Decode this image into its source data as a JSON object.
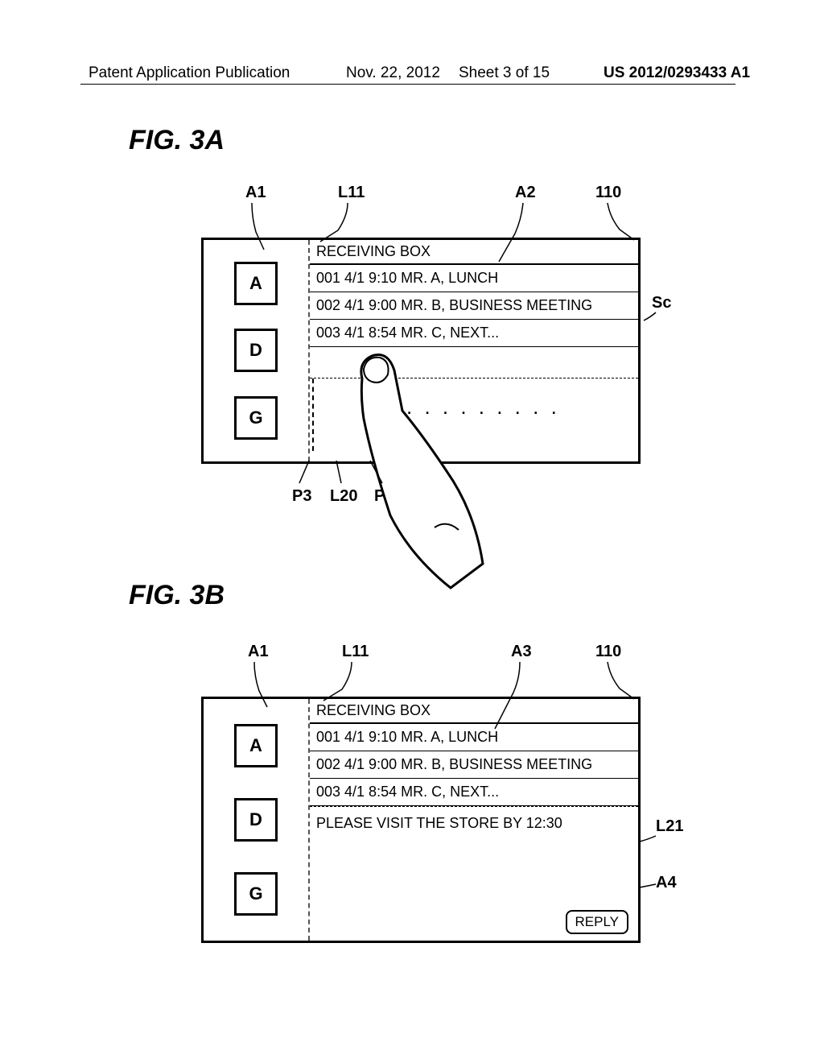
{
  "header": {
    "publication": "Patent Application Publication",
    "date": "Nov. 22, 2012",
    "sheet": "Sheet 3 of 15",
    "number": "US 2012/0293433 A1"
  },
  "figA": {
    "title": "FIG. 3A",
    "callouts": {
      "a1": "A1",
      "l11": "L11",
      "a2": "A2",
      "n110": "110",
      "sc": "Sc",
      "p3": "P3",
      "l20": "L20",
      "p4": "P4"
    },
    "sidebar": [
      "A",
      "D",
      "G"
    ],
    "screen_title": "RECEIVING BOX",
    "rows": [
      "001 4/1 9:10 MR. A, LUNCH",
      "002 4/1 9:00 MR. B, BUSINESS MEETING",
      "003 4/1 8:54 MR. C, NEXT..."
    ],
    "dots": ". . . . . . . . ."
  },
  "figB": {
    "title": "FIG. 3B",
    "callouts": {
      "a1": "A1",
      "l11": "L11",
      "a3": "A3",
      "n110": "110",
      "l21": "L21",
      "a4": "A4"
    },
    "sidebar": [
      "A",
      "D",
      "G"
    ],
    "screen_title": "RECEIVING BOX",
    "rows": [
      "001 4/1 9:10 MR. A, LUNCH",
      "002 4/1 9:00 MR. B, BUSINESS MEETING",
      "003 4/1 8:54 MR. C, NEXT..."
    ],
    "detail": "PLEASE VISIT THE STORE BY 12:30",
    "reply": "REPLY"
  }
}
